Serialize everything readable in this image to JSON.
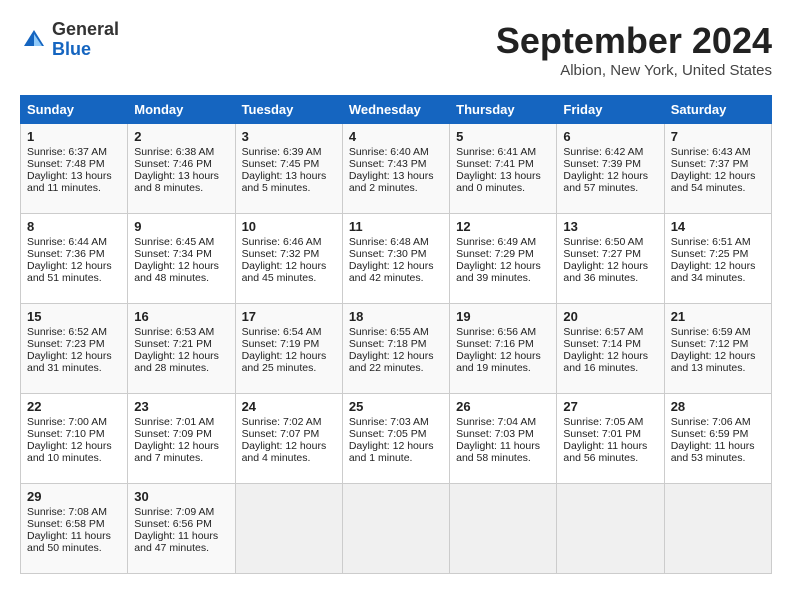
{
  "header": {
    "logo_general": "General",
    "logo_blue": "Blue",
    "month": "September 2024",
    "location": "Albion, New York, United States"
  },
  "days_of_week": [
    "Sunday",
    "Monday",
    "Tuesday",
    "Wednesday",
    "Thursday",
    "Friday",
    "Saturday"
  ],
  "weeks": [
    [
      {
        "day": 1,
        "sunrise": "6:37 AM",
        "sunset": "7:48 PM",
        "daylight": "13 hours and 11 minutes."
      },
      {
        "day": 2,
        "sunrise": "6:38 AM",
        "sunset": "7:46 PM",
        "daylight": "13 hours and 8 minutes."
      },
      {
        "day": 3,
        "sunrise": "6:39 AM",
        "sunset": "7:45 PM",
        "daylight": "13 hours and 5 minutes."
      },
      {
        "day": 4,
        "sunrise": "6:40 AM",
        "sunset": "7:43 PM",
        "daylight": "13 hours and 2 minutes."
      },
      {
        "day": 5,
        "sunrise": "6:41 AM",
        "sunset": "7:41 PM",
        "daylight": "13 hours and 0 minutes."
      },
      {
        "day": 6,
        "sunrise": "6:42 AM",
        "sunset": "7:39 PM",
        "daylight": "12 hours and 57 minutes."
      },
      {
        "day": 7,
        "sunrise": "6:43 AM",
        "sunset": "7:37 PM",
        "daylight": "12 hours and 54 minutes."
      }
    ],
    [
      {
        "day": 8,
        "sunrise": "6:44 AM",
        "sunset": "7:36 PM",
        "daylight": "12 hours and 51 minutes."
      },
      {
        "day": 9,
        "sunrise": "6:45 AM",
        "sunset": "7:34 PM",
        "daylight": "12 hours and 48 minutes."
      },
      {
        "day": 10,
        "sunrise": "6:46 AM",
        "sunset": "7:32 PM",
        "daylight": "12 hours and 45 minutes."
      },
      {
        "day": 11,
        "sunrise": "6:48 AM",
        "sunset": "7:30 PM",
        "daylight": "12 hours and 42 minutes."
      },
      {
        "day": 12,
        "sunrise": "6:49 AM",
        "sunset": "7:29 PM",
        "daylight": "12 hours and 39 minutes."
      },
      {
        "day": 13,
        "sunrise": "6:50 AM",
        "sunset": "7:27 PM",
        "daylight": "12 hours and 36 minutes."
      },
      {
        "day": 14,
        "sunrise": "6:51 AM",
        "sunset": "7:25 PM",
        "daylight": "12 hours and 34 minutes."
      }
    ],
    [
      {
        "day": 15,
        "sunrise": "6:52 AM",
        "sunset": "7:23 PM",
        "daylight": "12 hours and 31 minutes."
      },
      {
        "day": 16,
        "sunrise": "6:53 AM",
        "sunset": "7:21 PM",
        "daylight": "12 hours and 28 minutes."
      },
      {
        "day": 17,
        "sunrise": "6:54 AM",
        "sunset": "7:19 PM",
        "daylight": "12 hours and 25 minutes."
      },
      {
        "day": 18,
        "sunrise": "6:55 AM",
        "sunset": "7:18 PM",
        "daylight": "12 hours and 22 minutes."
      },
      {
        "day": 19,
        "sunrise": "6:56 AM",
        "sunset": "7:16 PM",
        "daylight": "12 hours and 19 minutes."
      },
      {
        "day": 20,
        "sunrise": "6:57 AM",
        "sunset": "7:14 PM",
        "daylight": "12 hours and 16 minutes."
      },
      {
        "day": 21,
        "sunrise": "6:59 AM",
        "sunset": "7:12 PM",
        "daylight": "12 hours and 13 minutes."
      }
    ],
    [
      {
        "day": 22,
        "sunrise": "7:00 AM",
        "sunset": "7:10 PM",
        "daylight": "12 hours and 10 minutes."
      },
      {
        "day": 23,
        "sunrise": "7:01 AM",
        "sunset": "7:09 PM",
        "daylight": "12 hours and 7 minutes."
      },
      {
        "day": 24,
        "sunrise": "7:02 AM",
        "sunset": "7:07 PM",
        "daylight": "12 hours and 4 minutes."
      },
      {
        "day": 25,
        "sunrise": "7:03 AM",
        "sunset": "7:05 PM",
        "daylight": "12 hours and 1 minute."
      },
      {
        "day": 26,
        "sunrise": "7:04 AM",
        "sunset": "7:03 PM",
        "daylight": "11 hours and 58 minutes."
      },
      {
        "day": 27,
        "sunrise": "7:05 AM",
        "sunset": "7:01 PM",
        "daylight": "11 hours and 56 minutes."
      },
      {
        "day": 28,
        "sunrise": "7:06 AM",
        "sunset": "6:59 PM",
        "daylight": "11 hours and 53 minutes."
      }
    ],
    [
      {
        "day": 29,
        "sunrise": "7:08 AM",
        "sunset": "6:58 PM",
        "daylight": "11 hours and 50 minutes."
      },
      {
        "day": 30,
        "sunrise": "7:09 AM",
        "sunset": "6:56 PM",
        "daylight": "11 hours and 47 minutes."
      },
      null,
      null,
      null,
      null,
      null
    ]
  ]
}
